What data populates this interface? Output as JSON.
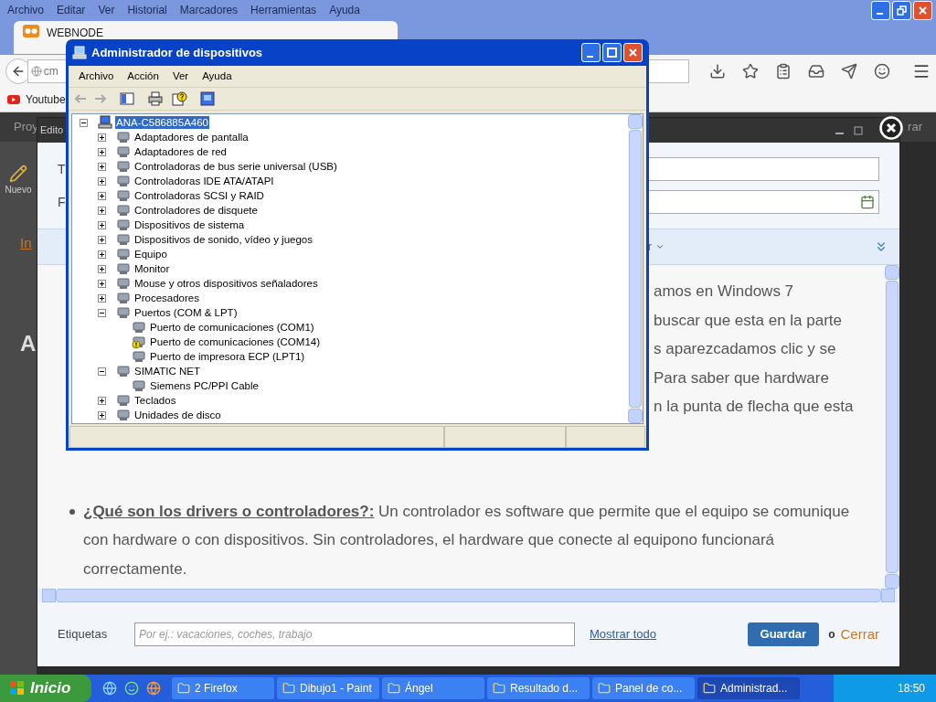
{
  "browser": {
    "menu": [
      "Archivo",
      "Editar",
      "Ver",
      "Historial",
      "Marcadores",
      "Herramientas",
      "Ayuda"
    ],
    "tabs": [
      {
        "label": "WEBNODE",
        "selected": true
      }
    ],
    "url": "cm",
    "bookmarks": [
      "Youtube"
    ]
  },
  "page": {
    "toolbar_left": "Proy",
    "toolbar_right": "rar",
    "tool_label": "Nuevo",
    "side_link": "In",
    "side_heading": "A"
  },
  "editor": {
    "title": "Edito",
    "field_labels": [
      "T",
      "F"
    ],
    "toolbar_fragment": "r",
    "article_lines": [
      "amos en Windows 7",
      "buscar que esta en la parte",
      "s aparezcadamos clic y se",
      "Para saber que hardware",
      "n la punta de flecha que esta"
    ],
    "bullet": {
      "term": "¿Qué son los drivers o controladores?:",
      "text": "Un controlador es software que permite que el equipo se comunique con hardware o con dispositivos. Sin controladores, el hardware que conecte al equipono funcionará correctamente."
    },
    "tags_label": "Etiquetas",
    "tags_placeholder": "Por ej.: vacaciones, coches, trabajo",
    "show_all": "Mostrar todo",
    "save": "Guardar",
    "or": "o",
    "close": "Cerrar"
  },
  "device_manager": {
    "title": "Administrador de dispositivos",
    "menu": [
      "Archivo",
      "Acción",
      "Ver",
      "Ayuda"
    ],
    "tree": {
      "label": "ANA-C586885A460",
      "selected": true,
      "expanded": true,
      "children": [
        {
          "label": "Adaptadores de pantalla",
          "expanded": false
        },
        {
          "label": "Adaptadores de red",
          "expanded": false
        },
        {
          "label": "Controladoras de bus serie universal (USB)",
          "expanded": false
        },
        {
          "label": "Controladoras IDE ATA/ATAPI",
          "expanded": false
        },
        {
          "label": "Controladoras SCSI y RAID",
          "expanded": false
        },
        {
          "label": "Controladores de disquete",
          "expanded": false
        },
        {
          "label": "Dispositivos de sistema",
          "expanded": false
        },
        {
          "label": "Dispositivos de sonido, vídeo y juegos",
          "expanded": false
        },
        {
          "label": "Equipo",
          "expanded": false
        },
        {
          "label": "Monitor",
          "expanded": false
        },
        {
          "label": "Mouse y otros dispositivos señaladores",
          "expanded": false
        },
        {
          "label": "Procesadores",
          "expanded": false
        },
        {
          "label": "Puertos (COM & LPT)",
          "expanded": true,
          "children": [
            {
              "label": "Puerto de comunicaciones (COM1)",
              "warning": false
            },
            {
              "label": "Puerto de comunicaciones (COM14)",
              "warning": true
            },
            {
              "label": "Puerto de impresora ECP (LPT1)",
              "warning": false
            }
          ]
        },
        {
          "label": "SIMATIC NET",
          "expanded": true,
          "children": [
            {
              "label": "Siemens PC/PPI Cable",
              "warning": false
            }
          ]
        },
        {
          "label": "Teclados",
          "expanded": false
        },
        {
          "label": "Unidades de disco",
          "expanded": false
        }
      ]
    }
  },
  "taskbar": {
    "start": "Inicio",
    "items": [
      {
        "label": "2 Firefox",
        "selected": false
      },
      {
        "label": "Dibujo1 - Paint",
        "selected": false
      },
      {
        "label": "Ángel",
        "selected": false
      },
      {
        "label": "Resultado d...",
        "selected": false
      },
      {
        "label": "Panel de co...",
        "selected": false
      },
      {
        "label": "Administrad...",
        "selected": true
      }
    ],
    "clock": "18:50"
  }
}
